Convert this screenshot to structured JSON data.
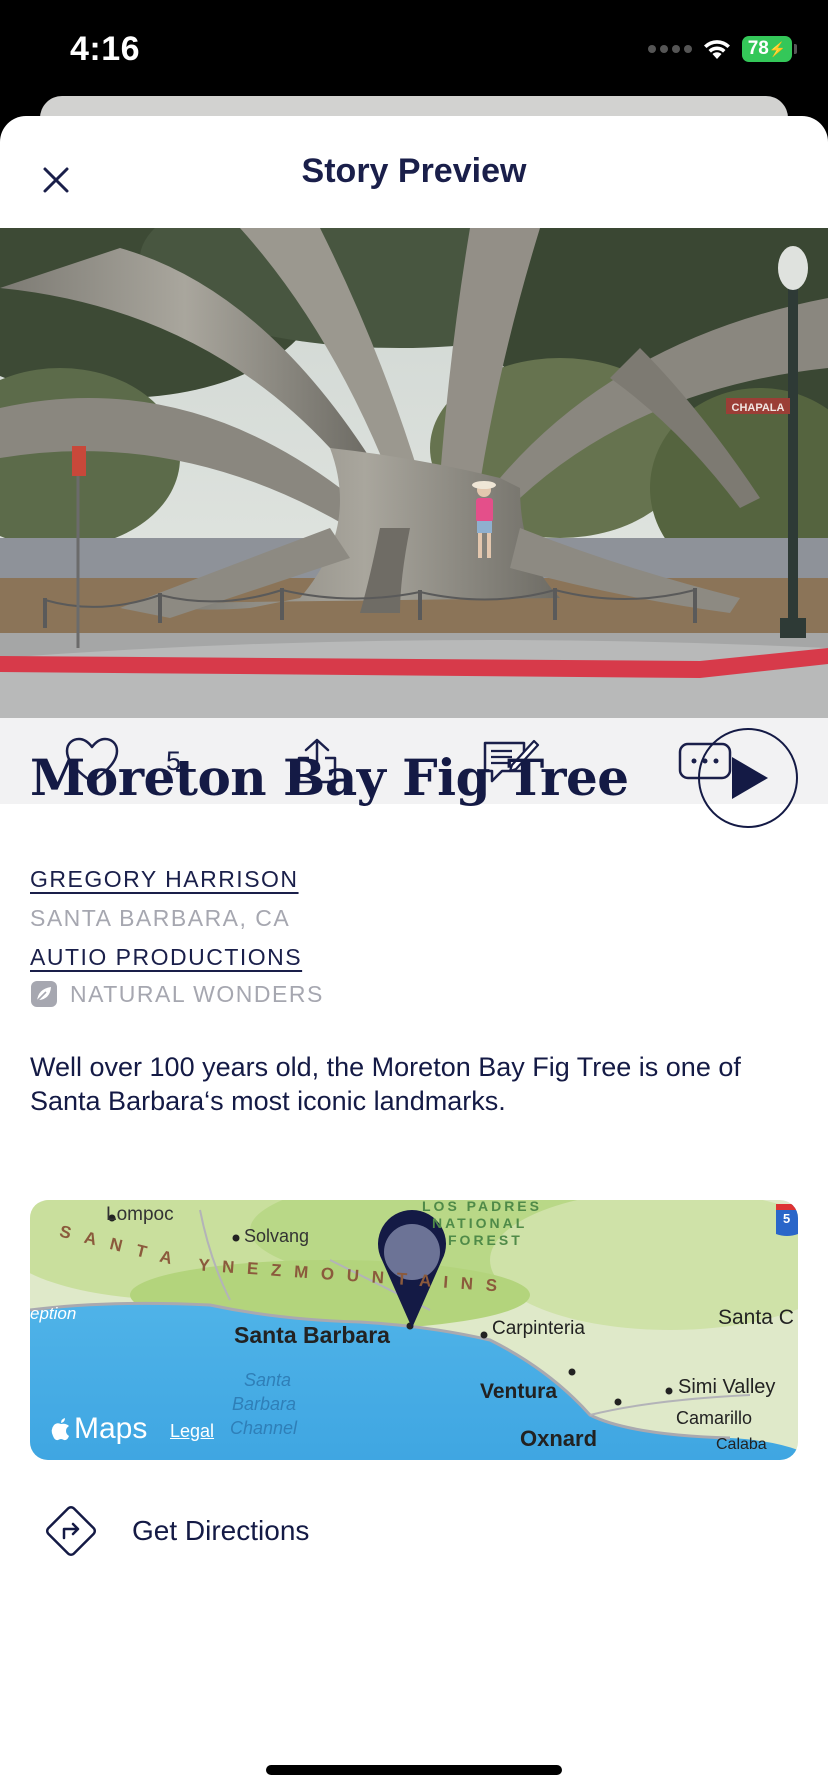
{
  "status_bar": {
    "time": "4:16",
    "battery": "78"
  },
  "header": {
    "title": "Story Preview"
  },
  "actions": {
    "like_count": "5"
  },
  "story": {
    "title": "Moreton Bay Fig Tree",
    "author": "GREGORY HARRISON",
    "location": "SANTA BARBARA, CA",
    "producer": "AUTIO PRODUCTIONS",
    "category": "NATURAL WONDERS",
    "description": "Well over 100 years old, the Moreton Bay Fig Tree is one of Santa Barbara‘s most iconic landmarks."
  },
  "hero_sign": "CHAPALA",
  "map": {
    "labels": {
      "lompoc": "Lompoc",
      "solvang": "Solvang",
      "los_padres_1": "LOS PADRES",
      "los_padres_2": "NATIONAL",
      "los_padres_3": "FOREST",
      "santa_ynez_1": "S A N T A",
      "santa_ynez_2": "Y N E Z   M O U N T A I N S",
      "reception": "eption",
      "santa_barbara": "Santa Barbara",
      "carpinteria": "Carpinteria",
      "santa_c": "Santa C",
      "ventura": "Ventura",
      "simi_valley": "Simi Valley",
      "oxnard": "Oxnard",
      "camarillo": "Camarillo",
      "calabasas": "Calaba",
      "channel_1": "Santa",
      "channel_2": "Barbara",
      "channel_3": "Channel",
      "highway": "5"
    },
    "brand": "Maps",
    "legal": "Legal"
  },
  "directions": {
    "label": "Get Directions"
  },
  "colors": {
    "navy": "#141a45",
    "battery_green": "#34c759",
    "action_bar": "#f2f2f3",
    "muted": "#a6a7b0"
  }
}
